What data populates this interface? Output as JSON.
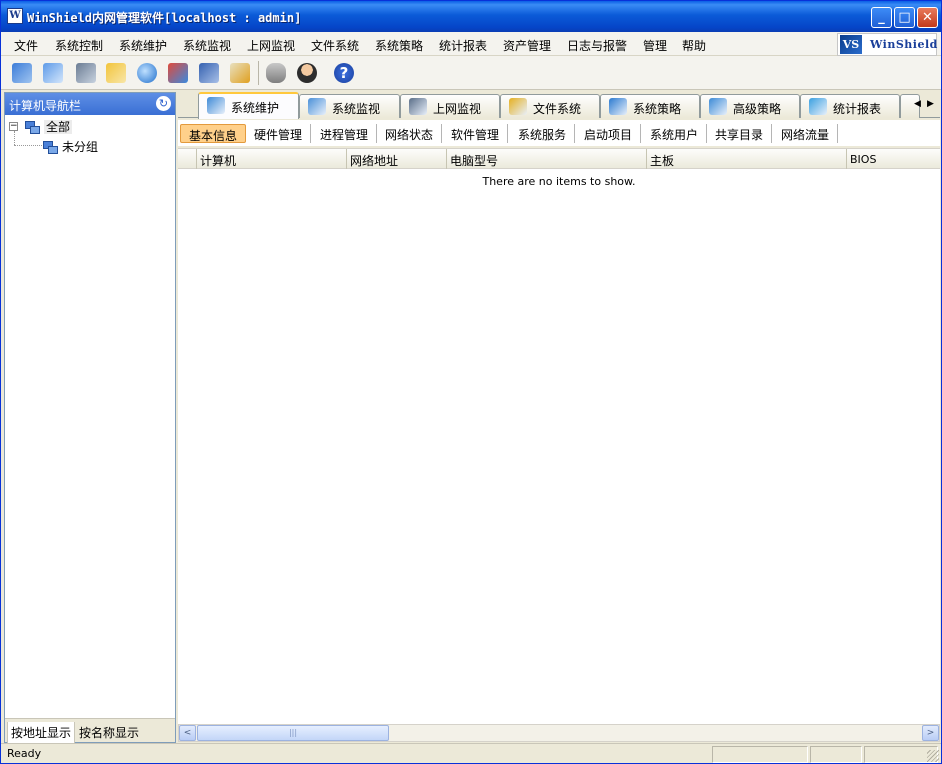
{
  "window": {
    "title": "WinShield内网管理软件[localhost : admin]",
    "minimize": "_",
    "maximize": "□",
    "close": "✕"
  },
  "logo": {
    "mark": "VS",
    "text": "WinShield"
  },
  "menu": [
    "文件",
    "系统控制",
    "系统维护",
    "系统监视",
    "上网监视",
    "文件系统",
    "系统策略",
    "统计报表",
    "资产管理",
    "日志与报警",
    "管理",
    "帮助"
  ],
  "toolbar": {
    "icons": [
      "maintenance-icon",
      "monitor-icon",
      "web-monitor-icon",
      "file-system-icon",
      "policy-icon",
      "advanced-policy-icon",
      "report-icon",
      "asset-icon",
      "database-icon",
      "user-icon",
      "help-icon"
    ],
    "help_glyph": "?"
  },
  "navigator": {
    "title": "计算机导航栏",
    "refresh_glyph": "↻",
    "expander": "−",
    "tree": [
      {
        "label": "全部"
      },
      {
        "label": "未分组"
      }
    ],
    "bottom_tabs": [
      "按地址显示",
      "按名称显示"
    ]
  },
  "tabs": [
    "系统维护",
    "系统监视",
    "上网监视",
    "文件系统",
    "系统策略",
    "高级策略",
    "统计报表"
  ],
  "tab_colors": [
    "#3e8ad6",
    "#4a90d8",
    "#5a6e88",
    "#e5b020",
    "#2b7ad0",
    "#3b8ad6",
    "#3aa0e0"
  ],
  "tab_scroll": {
    "left": "◀",
    "right": "▶"
  },
  "subtabs": [
    "基本信息",
    "硬件管理",
    "进程管理",
    "网络状态",
    "软件管理",
    "系统服务",
    "启动项目",
    "系统用户",
    "共享目录",
    "网络流量"
  ],
  "list": {
    "columns": [
      "计算机",
      "网络地址",
      "电脑型号",
      "主板",
      "BIOS"
    ],
    "empty_message": "There are no items to show."
  },
  "scrollbar": {
    "left": "<",
    "right": ">",
    "thumb": "|||"
  },
  "status": {
    "text": "Ready"
  }
}
